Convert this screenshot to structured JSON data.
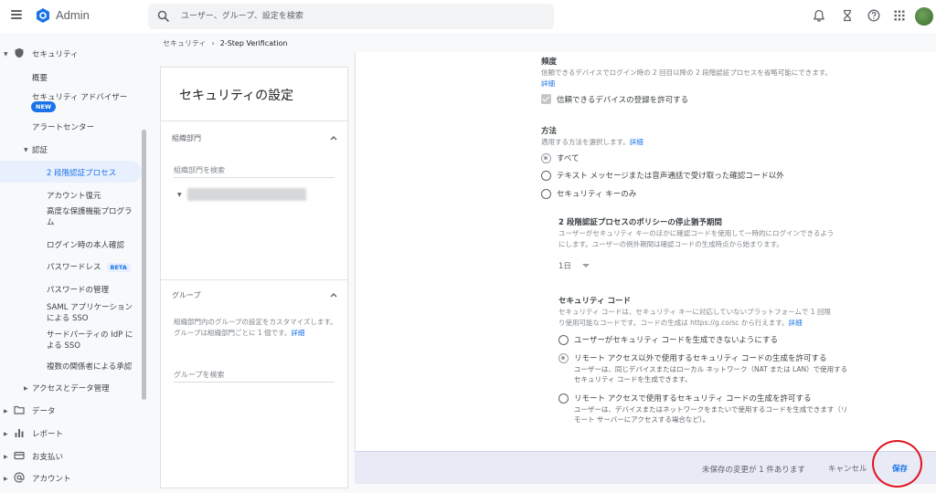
{
  "app": {
    "title": "Admin",
    "search_placeholder": "ユーザー、グループ、設定を検索"
  },
  "icons": {
    "menu": "menu-icon",
    "logo": "admin-hexagon-logo",
    "search": "search-icon",
    "bell": "bell-icon",
    "hourglass": "hourglass-icon",
    "help": "help-icon",
    "apps": "apps-grid-icon"
  },
  "colors": {
    "accent": "#1a73e8",
    "active_bg": "#e8f0fe",
    "savebar_bg": "#e8eaf6",
    "highlight_ring": "#e0141e"
  },
  "breadcrumb": {
    "parent": "セキュリティ",
    "separator": "›",
    "current": "2-Step Verification"
  },
  "sidebar": {
    "security": "セキュリティ",
    "overview": "概要",
    "advisor": "セキュリティ アドバイザー",
    "new_badge": "NEW",
    "alert_center": "アラートセンター",
    "auth": "認証",
    "two_step": "2 段階認証プロセス",
    "account_recovery": "アカウント復元",
    "advanced_protection": "高度な保護機能プログラム",
    "login_challenge": "ログイン時の本人確認",
    "passwordless": "パスワードレス",
    "beta_badge": "BETA",
    "password_management": "パスワードの管理",
    "saml": "SAML アプリケーション による SSO",
    "third_party": "サードパーティの IdP に よる SSO",
    "multi_party": "複数の関係者による承認",
    "access_data": "アクセスとデータ管理",
    "data": "データ",
    "reports": "レポート",
    "billing": "お支払い",
    "account": "アカウント"
  },
  "panel": {
    "title": "セキュリティの設定",
    "org_section": "組織部門",
    "org_search_placeholder": "組織部門を検索",
    "group_section": "グループ",
    "group_desc": "組織部門内のグループの設定をカスタマイズします。グループは組織部門ごとに 1 個です。",
    "group_link": "詳細",
    "group_search_placeholder": "グループを検索"
  },
  "frequency": {
    "title": "頻度",
    "desc": "信頼できるデバイスでログイン時の 2 回目以降の 2 段階認証プロセスを省略可能にできます。",
    "link": "詳細",
    "checkbox_label": "信頼できるデバイスの登録を許可する",
    "checked": true
  },
  "method": {
    "title": "方法",
    "desc": "適用する方法を選択します。",
    "link": "詳細",
    "options": [
      "すべて",
      "テキスト メッセージまたは音声通話で受け取った確認コード以外",
      "セキュリティ キーのみ"
    ],
    "selected": "すべて"
  },
  "grace": {
    "title": "2 段階認証プロセスのポリシーの停止猶予期間",
    "desc": "ユーザーがセキュリティ キーのほかに確認コードを使用して一時的にログインできるようにします。ユーザーの例外期間は確認コードの生成時点から始まります。",
    "value": "1日"
  },
  "code": {
    "title": "セキュリティ コード",
    "desc": "セキュリティ コードは、セキュリティ キーに対応していないプラットフォームで 1 回限り使用可能なコードです。コードの生成は https://g.co/sc から行えます。",
    "link": "詳細",
    "opt1": "ユーザーがセキュリティ コードを生成できないようにする",
    "opt2": "リモート アクセス以外で使用するセキュリティ コードの生成を許可する",
    "opt2_sub": "ユーザーは、同じデバイスまたはローカル ネットワーク（NAT または LAN）で使用するセキュリティ コードを生成できます。",
    "opt3": "リモート アクセスで使用するセキュリティ コードの生成を許可する",
    "opt3_sub": "ユーザーは、デバイスまたはネットワークをまたいで使用するコードを生成できます（リモート サーバーにアクセスする場合など）。",
    "selected": "opt2"
  },
  "savebar": {
    "unsaved": "未保存の変更が 1 件あります",
    "cancel": "キャンセル",
    "save": "保存"
  }
}
